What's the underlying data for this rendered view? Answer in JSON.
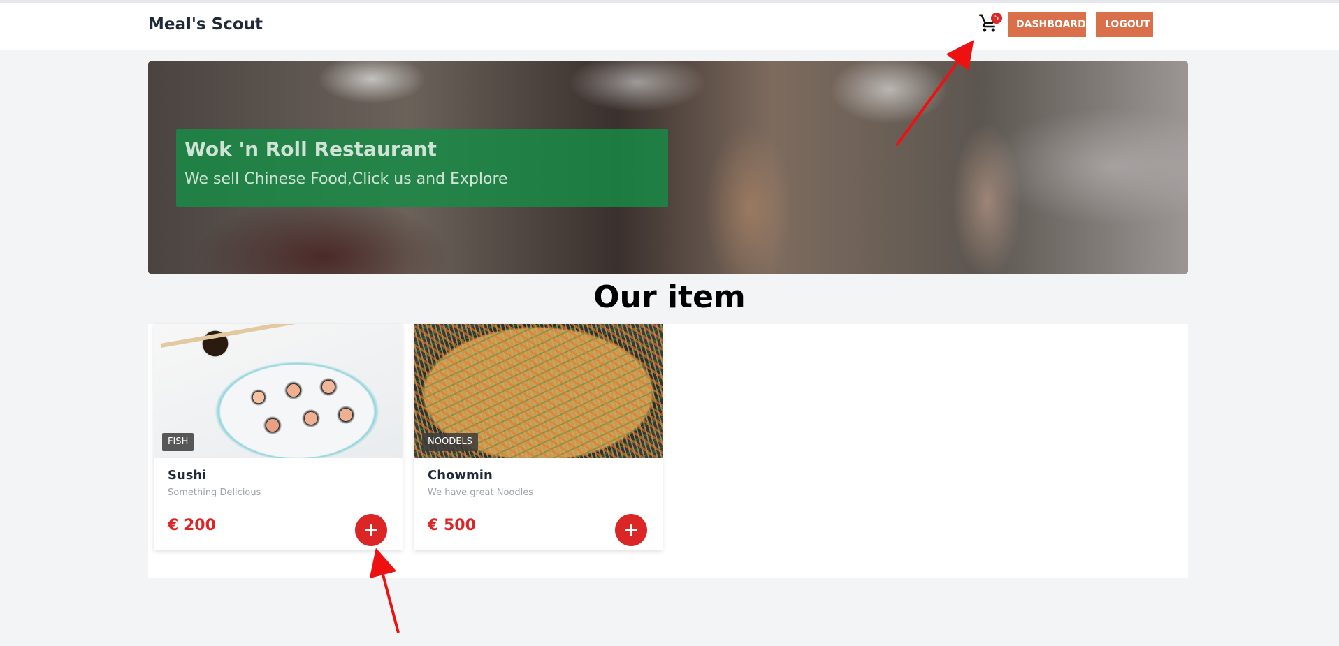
{
  "header": {
    "brand": "Meal's Scout",
    "cart_count": "5",
    "dashboard_label": "DASHBOARD",
    "logout_label": "LOGOUT"
  },
  "hero": {
    "title": "Wok 'n Roll Restaurant",
    "subtitle": "We sell Chinese Food,Click us and Explore"
  },
  "section": {
    "title": "Our item"
  },
  "items": [
    {
      "category": "FISH",
      "name": "Sushi",
      "description": "Something Delicious",
      "price": "€ 200",
      "add_label": "+"
    },
    {
      "category": "NOODELS",
      "name": "Chowmin",
      "description": "We have great Noodles",
      "price": "€ 500",
      "add_label": "+"
    }
  ],
  "colors": {
    "accent_button": "#d9704a",
    "price_red": "#dc2626",
    "hero_caption_green": "#168c46",
    "annotation_arrow": "#ee1111"
  },
  "icons": {
    "cart": "shopping-cart-icon",
    "add": "plus-icon"
  }
}
